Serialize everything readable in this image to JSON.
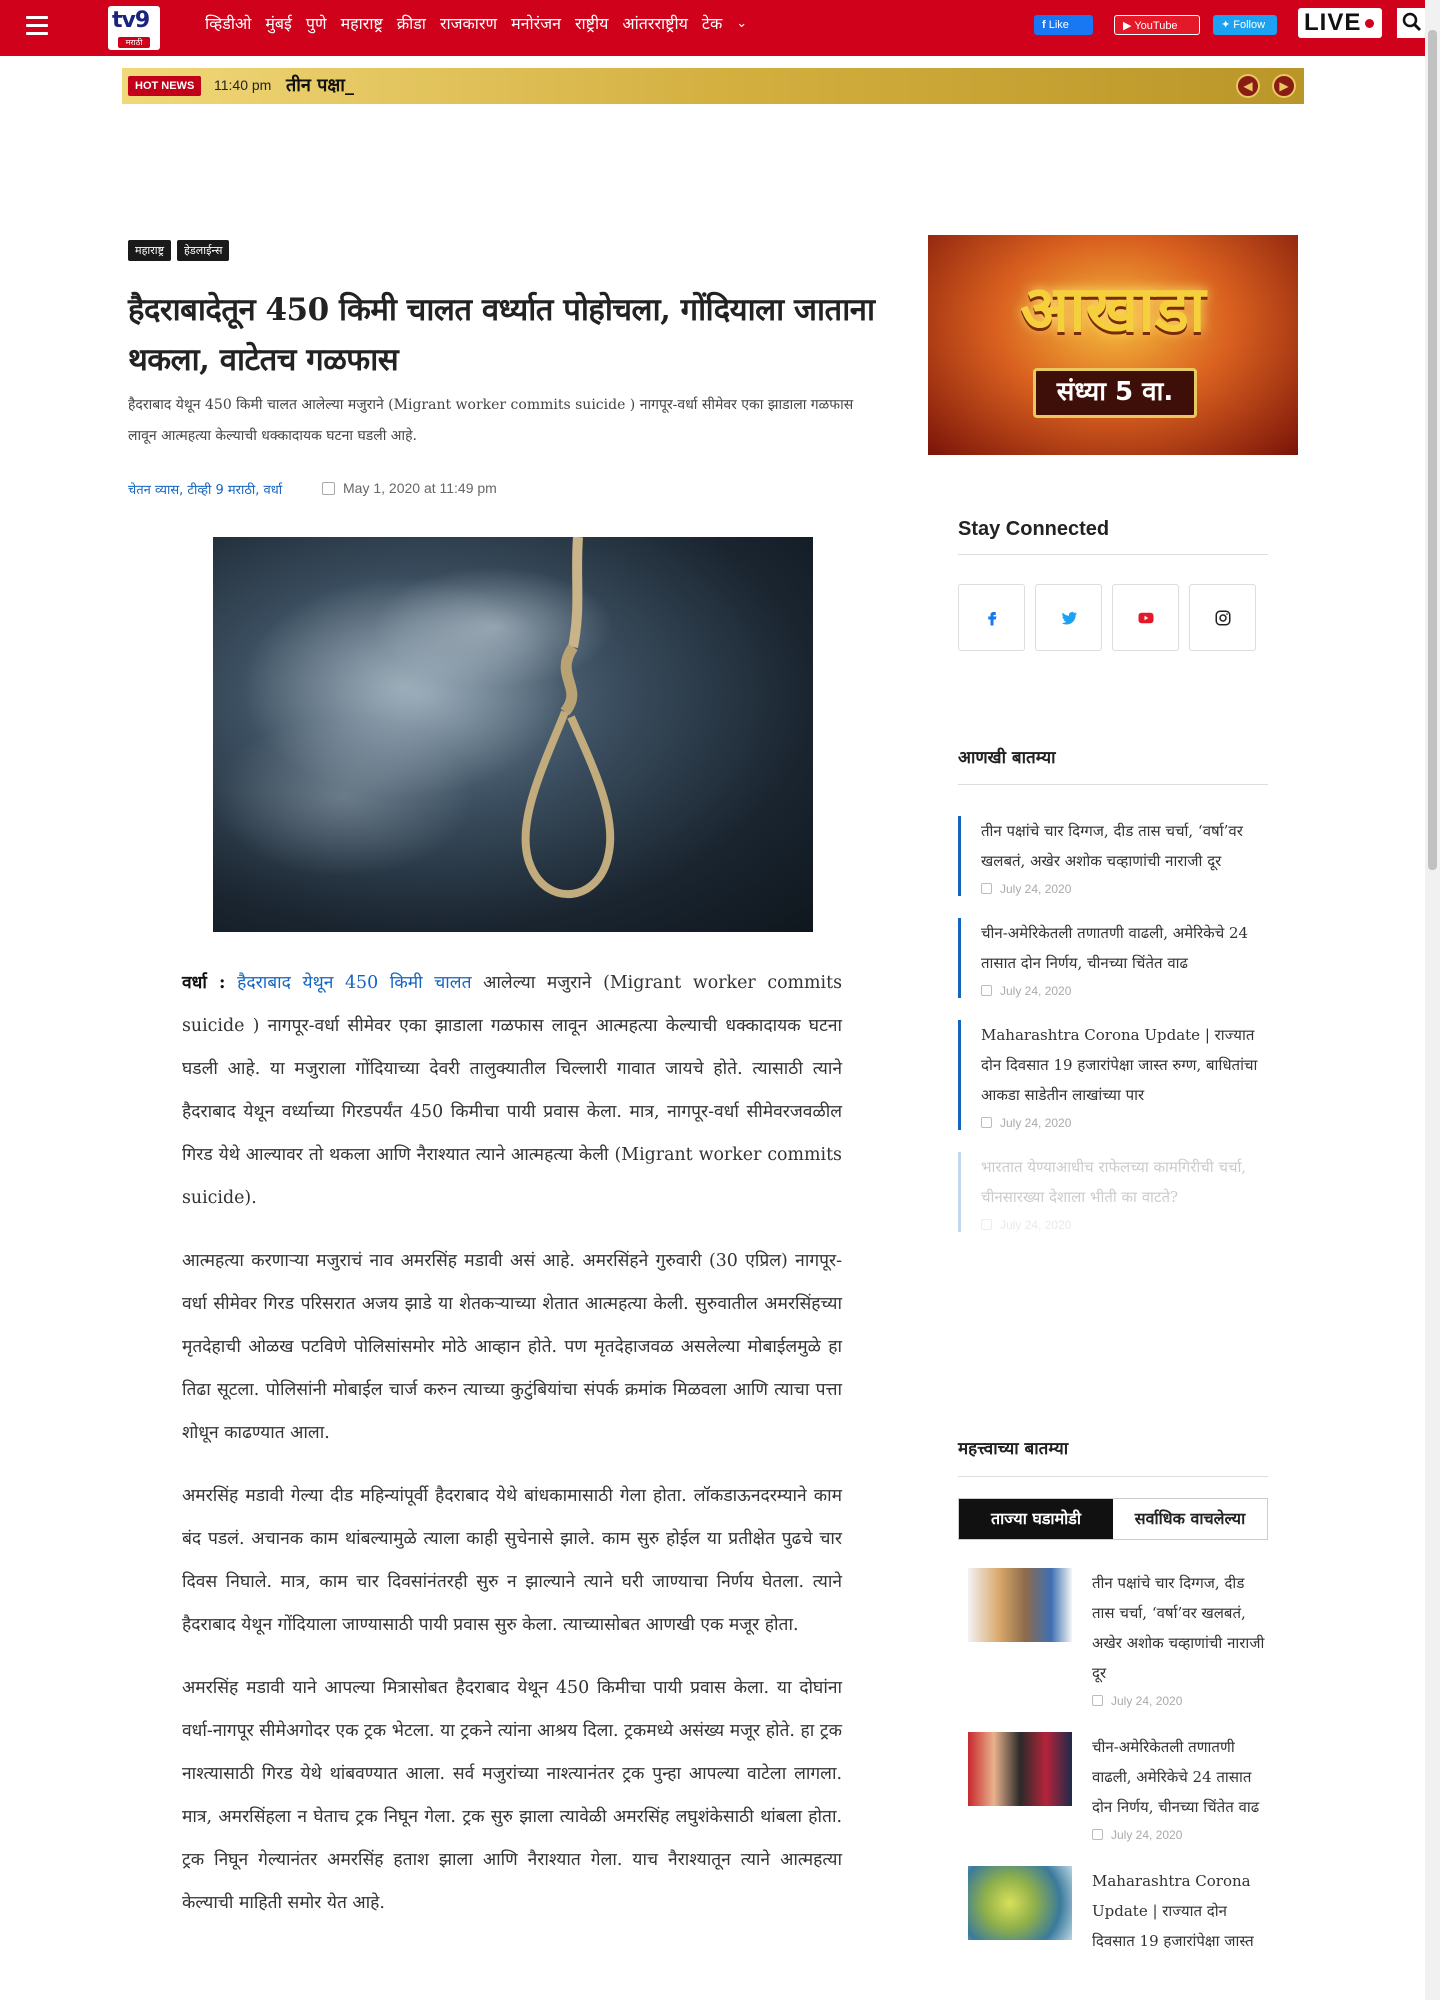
{
  "header": {
    "logo_text": "tv9",
    "logo_sub": "मराठी",
    "nav": [
      "व्हिडीओ",
      "मुंबई",
      "पुणे",
      "महाराष्ट्र",
      "क्रीडा",
      "राजकारण",
      "मनोरंजन",
      "राष्ट्रीय",
      "आंतरराष्ट्रीय",
      "टेक"
    ],
    "nav_more_icon": "chevron-down-icon",
    "facebook_label": "Like",
    "youtube_label": "YouTube",
    "twitter_label": "Follow",
    "live_label": "LIVE",
    "brand_color": "#d0021b"
  },
  "ticker": {
    "tag": "HOT NEWS",
    "time": "11:40 pm",
    "text": "तीन पक्षा_"
  },
  "article": {
    "tags": [
      "महाराष्ट्र",
      "हेडलाईन्स"
    ],
    "headline": "हैदराबादेतून 450 किमी चालत वर्ध्यात पोहोचला, गोंदियाला जाताना थकला, वाटेतच गळफास",
    "summary": "हैदराबाद येथून 450 किमी चालत आलेल्या मजुराने (Migrant worker commits suicide ) नागपूर-वर्धा सीमेवर एका झाडाला गळफास लावून आत्महत्या केल्याची धक्कादायक घटना घडली आहे.",
    "byline": "चेतन व्यास, टीव्ही 9 मराठी, वर्धा",
    "date": "May 1, 2020 at 11:49 pm",
    "image_icon": "noose-photo",
    "lead_place": "वर्धा :",
    "lead_link": "हैदराबाद येथून 450 किमी चालत",
    "p1_rest": " आलेल्या मजुराने (Migrant worker commits suicide ) नागपूर-वर्धा सीमेवर एका झाडाला गळफास लावून आत्महत्या केल्याची धक्कादायक घटना घडली आहे. या मजुराला गोंदियाच्या देवरी तालुक्यातील चिल्लारी गावात जायचे होते. त्यासाठी त्याने हैदराबाद येथून वर्ध्याच्या गिरडपर्यंत 450 किमीचा पायी प्रवास केला. मात्र, नागपूर-वर्धा सीमेवरजवळील गिरड येथे आल्यावर तो थकला आणि नैराश्यात त्याने आत्महत्या केली (Migrant worker commits suicide).",
    "p2": "आत्महत्या करणाऱ्या मजुराचं नाव अमरसिंह मडावी असं आहे. अमरसिंहने गुरुवारी (30 एप्रिल) नागपूर-वर्धा सीमेवर गिरड परिसरात अजय झाडे या शेतकऱ्याच्या शेतात आत्महत्या केली. सुरुवातील अमरसिंहच्या मृतदेहाची ओळख पटविणे पोलिसांसमोर मोठे आव्हान होते. पण मृतदेहाजवळ असलेल्या मोबाईलमुळे हा तिढा सूटला. पोलिसांनी मोबाईल चार्ज करुन त्याच्या कुटुंबियांचा संपर्क क्रमांक मिळवला आणि त्याचा पत्ता शोधून काढण्यात आला.",
    "p3": "अमरसिंह मडावी गेल्या दीड महिन्यांपूर्वी हैदराबाद येथे बांधकामासाठी गेला होता. लॉकडाऊनदरम्याने काम बंद पडलं. अचानक काम थांबल्यामुळे त्याला काही सुचेनासे झाले. काम सुरु होईल या प्रतीक्षेत पुढचे चार दिवस निघाले. मात्र, काम चार दिवसांनंतरही सुरु न झाल्याने त्याने घरी जाण्याचा निर्णय घेतला. त्याने हैदराबाद येथून गोंदियाला जाण्यासाठी पायी प्रवास सुरु केला. त्याच्यासोबत आणखी एक मजूर होता.",
    "p4": "अमरसिंह मडावी याने आपल्या मित्रासोबत हैदराबाद येथून 450 किमीचा पायी प्रवास केला. या दोघांना वर्धा-नागपूर सीमेअगोदर एक ट्रक भेटला. या ट्रकने त्यांना आश्रय दिला. ट्रकमध्ये असंख्य मजूर होते. हा ट्रक नाश्त्यासाठी गिरड येथे थांबवण्यात आला. सर्व मजुरांच्या नाश्त्यानंतर ट्रक पुन्हा आपल्या वाटेला लागला. मात्र, अमरसिंहला न घेताच ट्रक निघून गेला. ट्रक सुरु झाला त्यावेळी अमरसिंह लघुशंकेसाठी थांबला होता. ट्रक निघून गेल्यानंतर अमरसिंह हताश झाला आणि नैराश्यात गेला. याच नैराश्यातून त्याने आत्महत्या केल्याची माहिती समोर येत आहे."
  },
  "sidebar": {
    "promo_title": "आखाडा",
    "promo_time": "संध्या 5 वा.",
    "stay_connected": "Stay Connected",
    "social_icons": [
      "facebook-icon",
      "twitter-icon",
      "youtube-icon",
      "instagram-icon"
    ],
    "more_news_heading": "आणखी बातम्या",
    "more_news": [
      {
        "title": "तीन पक्षांचे चार दिग्गज, दीड तास चर्चा, ‘वर्षा’वर खलबतं, अखेर अशोक चव्हाणांची नाराजी दूर",
        "date": "July 24, 2020"
      },
      {
        "title": "चीन-अमेरिकेतली तणातणी वाढली, अमेरिकेचे 24 तासात दोन निर्णय, चीनच्या चिंतेत वाढ",
        "date": "July 24, 2020"
      },
      {
        "title": "Maharashtra Corona Update | राज्यात दोन दिवसात 19 हजारांपेक्षा जास्त रुग्ण, बाधितांचा आकडा साडेतीन लाखांच्या पार",
        "date": "July 24, 2020"
      },
      {
        "title": "भारतात येण्याआधीच राफेलच्या कामगिरीची चर्चा, चीनसारख्या देशाला भीती का वाटते?",
        "date": "July 24, 2020"
      }
    ],
    "important_heading": "महत्त्वाच्या बातम्या",
    "tab_latest": "ताज्या घडामोडी",
    "tab_most_read": "सर्वाधिक वाचलेल्या",
    "important": [
      {
        "title": "तीन पक्षांचे चार दिग्गज, दीड तास चर्चा, ‘वर्षा’वर खलबतं, अखेर अशोक चव्हाणांची नाराजी दूर",
        "date": "July 24, 2020"
      },
      {
        "title": "चीन-अमेरिकेतली तणातणी वाढली, अमेरिकेचे 24 तासात दोन निर्णय, चीनच्या चिंतेत वाढ",
        "date": "July 24, 2020"
      },
      {
        "title": "Maharashtra Corona Update | राज्यात दोन दिवसात 19 हजारांपेक्षा जास्त",
        "date": ""
      }
    ]
  }
}
